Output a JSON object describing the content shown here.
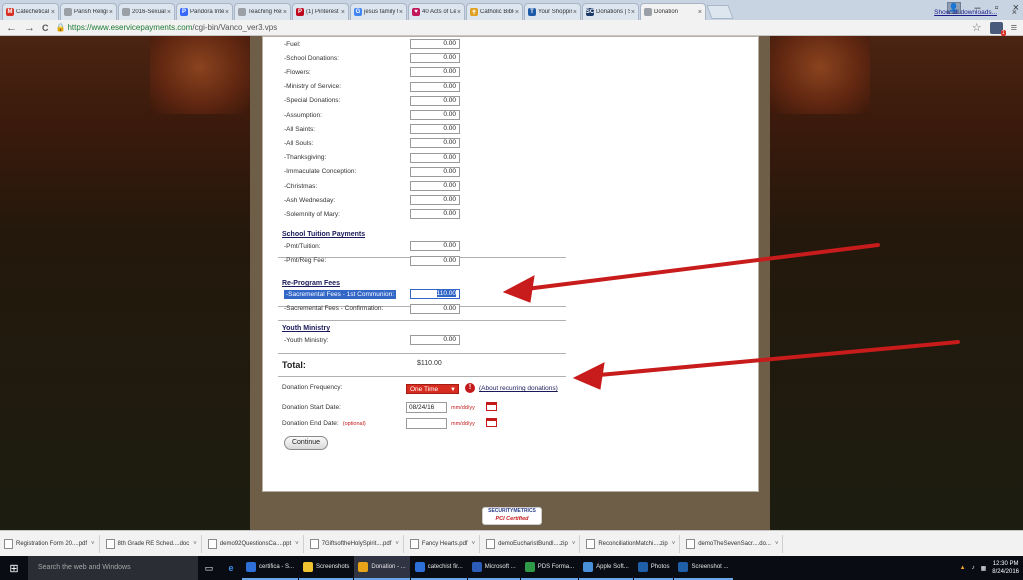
{
  "browser": {
    "tabs": [
      {
        "label": "Catechetical Le",
        "icon_color": "#d93025",
        "icon": "M"
      },
      {
        "label": "Parish Religious",
        "icon_color": "#9aa0a6",
        "icon": ""
      },
      {
        "label": "2016-Sexual-Mi",
        "icon_color": "#9aa0a6",
        "icon": ""
      },
      {
        "label": "Pandora Inte",
        "icon_color": "#3668ff",
        "icon": "P"
      },
      {
        "label": "Teaching Resou",
        "icon_color": "#9aa0a6",
        "icon": ""
      },
      {
        "label": "(1) Pinterest",
        "icon_color": "#bd081c",
        "icon": "P"
      },
      {
        "label": "jesus family tree",
        "icon_color": "#4285f4",
        "icon": "G"
      },
      {
        "label": "40 Acts of Lent",
        "icon_color": "#c2185b",
        "icon": "♥"
      },
      {
        "label": "Catholic Bible",
        "icon_color": "#e0a020",
        "icon": "✝"
      },
      {
        "label": "Your Shopping",
        "icon_color": "#1e5aa8",
        "icon": "T"
      },
      {
        "label": "Donations | St.",
        "icon_color": "#1a3a6a",
        "icon": "SC"
      },
      {
        "label": "Donation",
        "icon_color": "#9aa0a6",
        "icon": "",
        "active": true
      }
    ],
    "tab_close": "×",
    "nav": {
      "back": "←",
      "forward": "→",
      "reload": "C"
    },
    "url_secure": "https://www.eservicepayments.com",
    "url_path": "/cgi-bin/Vanco_ver3.vps",
    "window_controls": {
      "minimize": "–",
      "maximize": "▫",
      "close": "×"
    },
    "star": "☆",
    "menu": "≡",
    "ext_badge": "1"
  },
  "form": {
    "fund_rows": [
      {
        "label": "-Fuel:",
        "value": "0.00"
      },
      {
        "label": "-School Donations:",
        "value": "0.00"
      },
      {
        "label": "-Flowers:",
        "value": "0.00"
      },
      {
        "label": "-Ministry of Service:",
        "value": "0.00"
      },
      {
        "label": "-Special Donations:",
        "value": "0.00"
      },
      {
        "label": "-Assumption:",
        "value": "0.00"
      },
      {
        "label": "-All Saints:",
        "value": "0.00"
      },
      {
        "label": "-All Souls:",
        "value": "0.00"
      },
      {
        "label": "-Thanksgiving:",
        "value": "0.00"
      },
      {
        "label": "-Immaculate Conception:",
        "value": "0.00"
      },
      {
        "label": "-Christmas:",
        "value": "0.00"
      },
      {
        "label": "-Ash Wednesday:",
        "value": "0.00"
      },
      {
        "label": "-Solemnity of Mary:",
        "value": "0.00"
      }
    ],
    "tuition": {
      "title": "School Tuition Payments",
      "rows": [
        {
          "label": "-Pmt/Tuition:",
          "value": "0.00"
        },
        {
          "label": "-Pmt/Reg Fee:",
          "value": "0.00"
        }
      ]
    },
    "reprogram": {
      "title": "Re-Program Fees",
      "rows": [
        {
          "label": "-Sacremental Fees - 1st Communion:",
          "value": "110.00"
        },
        {
          "label": "-Sacremental Fees - Confirmation:",
          "value": "0.00"
        }
      ]
    },
    "youth": {
      "title": "Youth Ministry",
      "rows": [
        {
          "label": "-Youth Ministry:",
          "value": "0.00"
        }
      ]
    },
    "total_label": "Total:",
    "total_value": "$110.00",
    "frequency_label": "Donation Frequency:",
    "frequency_value": "One Time",
    "frequency_caret": "▼",
    "info_glyph": "!",
    "about_link": "(About recurring donations)",
    "start_label": "Donation Start Date:",
    "start_value": "08/24/16",
    "date_format": "mm/dd/yy",
    "end_label": "Donation End Date:",
    "end_optional": "(optional)",
    "end_value": "",
    "continue_label": "Continue",
    "pci_line1": "SECURITYMETRICS",
    "pci_line2": "PCI Certified"
  },
  "downloads": {
    "items": [
      {
        "label": "Registration Form 20....pdf"
      },
      {
        "label": "8th Grade RE Sched....doc"
      },
      {
        "label": "demo92QuestionsCa....ppt"
      },
      {
        "label": "7GiftsoftheHolySpirit....pdf"
      },
      {
        "label": "Fancy Hearts.pdf"
      },
      {
        "label": "demoEucharistBundl....zip"
      },
      {
        "label": "ReconciliationMatchi....zip"
      },
      {
        "label": "demoTheSevenSacr....do..."
      }
    ],
    "caret": "˅",
    "show_all": "Show all downloads...",
    "close": "×"
  },
  "taskbar": {
    "start_glyph": "⊞",
    "search_placeholder": "Search the web and Windows",
    "apps": [
      {
        "label": "certifica - S...",
        "color": "#2e6fd8"
      },
      {
        "label": "Screenshots",
        "color": "#f0c330"
      },
      {
        "label": "Donation - ...",
        "color": "#e8a318",
        "active": true
      },
      {
        "label": "catechist fir...",
        "color": "#2e6fd8"
      },
      {
        "label": "Microsoft ...",
        "color": "#2b5cb8"
      },
      {
        "label": "PDS Forma...",
        "color": "#2e9a48"
      },
      {
        "label": "Apple Soft...",
        "color": "#4a90d9"
      },
      {
        "label": "Photos",
        "color": "#1f5fa8"
      },
      {
        "label": "Screenshot ...",
        "color": "#1f5fa8"
      }
    ],
    "time": "12:30 PM",
    "date": "8/24/2016"
  }
}
